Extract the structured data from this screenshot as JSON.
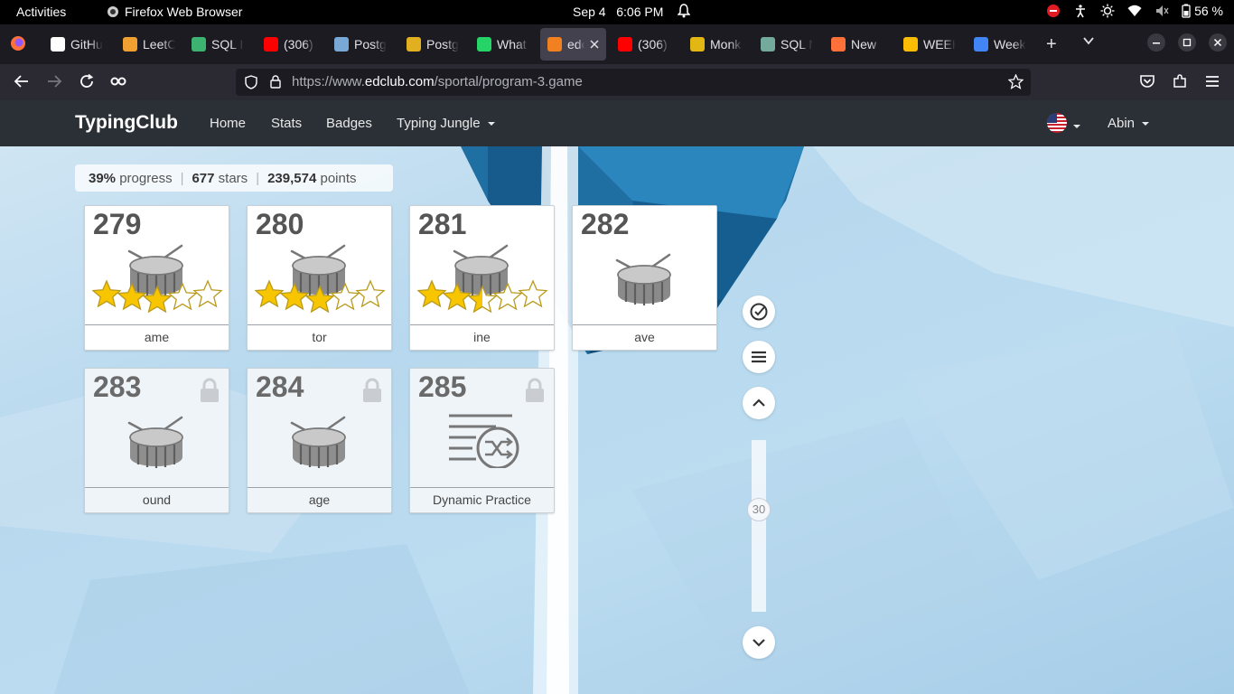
{
  "system_bar": {
    "activities": "Activities",
    "app_name": "Firefox Web Browser",
    "clock": "Sep 4   6:06 PM",
    "battery": "56 %"
  },
  "tabs": [
    {
      "label": "GitHu",
      "favicon": "github-icon",
      "color": "#ffffff"
    },
    {
      "label": "LeetC",
      "favicon": "leetcode-icon",
      "color": "#f0a030"
    },
    {
      "label": "SQL I",
      "favicon": "w3resource-icon",
      "color": "#3cb371"
    },
    {
      "label": "(306)",
      "favicon": "youtube-icon",
      "color": "#ff0000"
    },
    {
      "label": "Postg",
      "favicon": "postgres-icon",
      "color": "#7aa8d6"
    },
    {
      "label": "Postg",
      "favicon": "postgres-tutorial-icon",
      "color": "#e0b020"
    },
    {
      "label": "What",
      "favicon": "whatsapp-icon",
      "color": "#25d366"
    },
    {
      "label": "edc",
      "favicon": "edclub-icon",
      "color": "#f08020",
      "active": true
    },
    {
      "label": "(306)",
      "favicon": "youtube-icon",
      "color": "#ff0000"
    },
    {
      "label": "Monk",
      "favicon": "monkeytype-icon",
      "color": "#e2b714"
    },
    {
      "label": "SQL N",
      "favicon": "chatgpt-icon",
      "color": "#74aa9c"
    },
    {
      "label": "New",
      "favicon": "firefox-icon",
      "color": "#ff7139"
    },
    {
      "label": "WEEK",
      "favicon": "google-drive-icon",
      "color": "#fbbc04"
    },
    {
      "label": "Week",
      "favicon": "google-docs-icon",
      "color": "#4285f4"
    }
  ],
  "address_bar": {
    "url_prefix": "https://www.",
    "url_host": "edclub.com",
    "url_path": "/sportal/program-3.game"
  },
  "site_header": {
    "brand": "TypingClub",
    "nav": [
      "Home",
      "Stats",
      "Badges",
      "Typing Jungle"
    ],
    "user": "Abin"
  },
  "progress": {
    "percent": "39%",
    "percent_label": "progress",
    "stars": "677",
    "stars_label": "stars",
    "points": "239,574",
    "points_label": "points"
  },
  "lessons": [
    {
      "number": "279",
      "label": "ame",
      "stars_earned": 3,
      "stars_total": 5,
      "locked": false,
      "icon": "drum-icon"
    },
    {
      "number": "280",
      "label": "tor",
      "stars_earned": 3,
      "stars_total": 5,
      "locked": false,
      "icon": "drum-icon"
    },
    {
      "number": "281",
      "label": "ine",
      "stars_earned": 2.5,
      "stars_total": 5,
      "locked": false,
      "icon": "drum-icon"
    },
    {
      "number": "282",
      "label": "ave",
      "stars_earned": 0,
      "stars_total": 5,
      "locked": false,
      "icon": "drum-icon"
    },
    {
      "number": "283",
      "label": "ound",
      "locked": true,
      "icon": "drum-icon"
    },
    {
      "number": "284",
      "label": "age",
      "locked": true,
      "icon": "drum-icon"
    },
    {
      "number": "285",
      "label": "Dynamic Practice",
      "locked": true,
      "icon": "shuffle-list-icon"
    }
  ],
  "side_controls": {
    "slider_value": "30"
  }
}
